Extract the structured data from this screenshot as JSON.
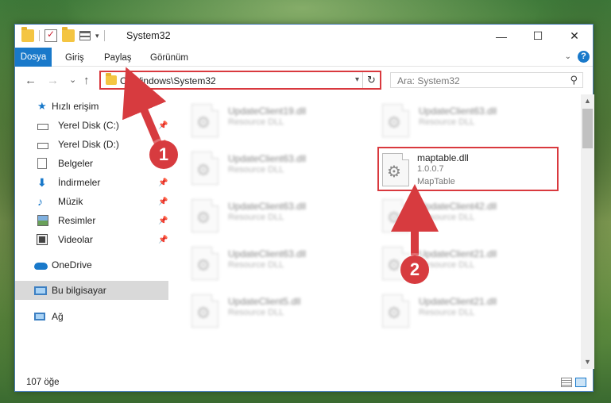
{
  "window": {
    "title": "System32",
    "minimize": "—",
    "maximize": "☐",
    "close": "✕"
  },
  "ribbon": {
    "tabs": [
      "Dosya",
      "Giriş",
      "Paylaş",
      "Görünüm"
    ],
    "help": "?"
  },
  "nav": {
    "back": "←",
    "forward": "→",
    "recent": "⌄",
    "up": "↑",
    "address": "C:\\Windows\\System32",
    "search_placeholder": "Ara: System32"
  },
  "sidebar": {
    "items": [
      {
        "label": "Hızlı erişim",
        "icon": "star-icon"
      },
      {
        "label": "Yerel Disk (C:)",
        "icon": "disk-icon",
        "pinned": true
      },
      {
        "label": "Yerel Disk (D:)",
        "icon": "disk-icon",
        "pinned": true
      },
      {
        "label": "Belgeler",
        "icon": "documents-icon",
        "pinned": true
      },
      {
        "label": "İndirmeler",
        "icon": "download-icon",
        "pinned": true
      },
      {
        "label": "Müzik",
        "icon": "music-icon",
        "pinned": true
      },
      {
        "label": "Resimler",
        "icon": "pictures-icon",
        "pinned": true
      },
      {
        "label": "Videolar",
        "icon": "videos-icon",
        "pinned": true
      },
      {
        "label": "OneDrive",
        "icon": "onedrive-icon"
      },
      {
        "label": "Bu bilgisayar",
        "icon": "computer-icon",
        "selected": true
      },
      {
        "label": "Ağ",
        "icon": "network-icon"
      }
    ]
  },
  "files": [
    {
      "name": "UpdateClient19.dll",
      "type": "Resource DLL"
    },
    {
      "name": "UpdateClient63.dll",
      "type": "Resource DLL"
    },
    {
      "name": "UpdateClient63.dll",
      "type": "Resource DLL"
    },
    {
      "name": "maptable.dll",
      "version": "1.0.0.7",
      "type": "MapTable",
      "highlighted": true
    },
    {
      "name": "UpdateClient63.dll",
      "type": "Resource DLL"
    },
    {
      "name": "UpdateClient42.dll",
      "type": "Resource DLL"
    },
    {
      "name": "UpdateClient63.dll",
      "type": "Resource DLL"
    },
    {
      "name": "UpdateClient21.dll",
      "type": "Resource DLL"
    },
    {
      "name": "UpdateClient5.dll",
      "type": "Resource DLL"
    },
    {
      "name": "UpdateClient21.dll",
      "type": "Resource DLL"
    }
  ],
  "status": {
    "count": "107 öğe"
  },
  "annotations": {
    "step1": "1",
    "step2": "2",
    "color": "#d73b3f"
  }
}
